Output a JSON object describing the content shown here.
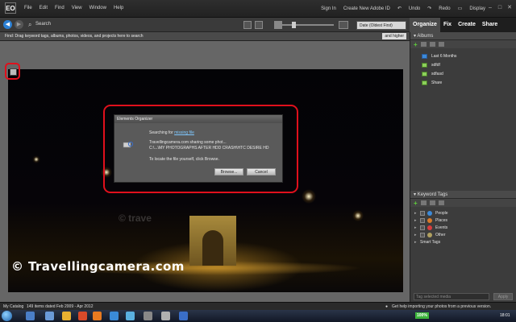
{
  "window": {
    "logo": "EO",
    "menu": [
      "File",
      "Edit",
      "Find",
      "View",
      "Window",
      "Help"
    ],
    "right_menu": [
      "Sign In",
      "Create New Adobe ID",
      "Undo",
      "Redo",
      "Display"
    ]
  },
  "toolbar": {
    "search_label": "Search",
    "sort_value": "Date (Oldest First)"
  },
  "findbar": {
    "hint": "Find: Drag keyword tags, albums, photos, videos, and projects here to search",
    "higher": "and higher"
  },
  "photo": {
    "watermark_top": "© trave",
    "watermark_bottom": "© Travellingcamera.com"
  },
  "dialog": {
    "title": "Elements Organizer",
    "searching_prefix": "Searching for",
    "searching_link": "missing file",
    "line1": "Travellingcamera.com sharing some phot...",
    "line2": "C:\\...\\MY PHOTOGRAPHS AFTER HDD CRASH\\HTC DESIRE HD",
    "line3": "To locate the file yourself, click Browse.",
    "browse": "Browse...",
    "cancel": "Cancel"
  },
  "tabs": [
    "Organize",
    "Fix",
    "Create",
    "Share"
  ],
  "albums": {
    "header": "Albums",
    "items": [
      {
        "label": "Last 6 Months",
        "smart": true
      },
      {
        "label": "sdfdf",
        "smart": false
      },
      {
        "label": "sdfasd",
        "smart": false
      },
      {
        "label": "Share",
        "smart": false
      }
    ]
  },
  "keyword_tags": {
    "header": "Keyword Tags",
    "items": [
      {
        "label": "People",
        "color": "#3c8ad8"
      },
      {
        "label": "Places",
        "color": "#d87a2a"
      },
      {
        "label": "Events",
        "color": "#d83c3c"
      },
      {
        "label": "Other",
        "color": "#b0a060"
      }
    ],
    "smart_tags": "Smart Tags",
    "field_placeholder": "Tag selected media",
    "apply": "Apply"
  },
  "status": {
    "catalog": "My Catalog",
    "items": "149 items dated Feb 2009 - Apr 2012",
    "help": "Get help importing your photos from a previous version."
  },
  "taskbar": {
    "battery": "100%",
    "clock": "18:01"
  }
}
